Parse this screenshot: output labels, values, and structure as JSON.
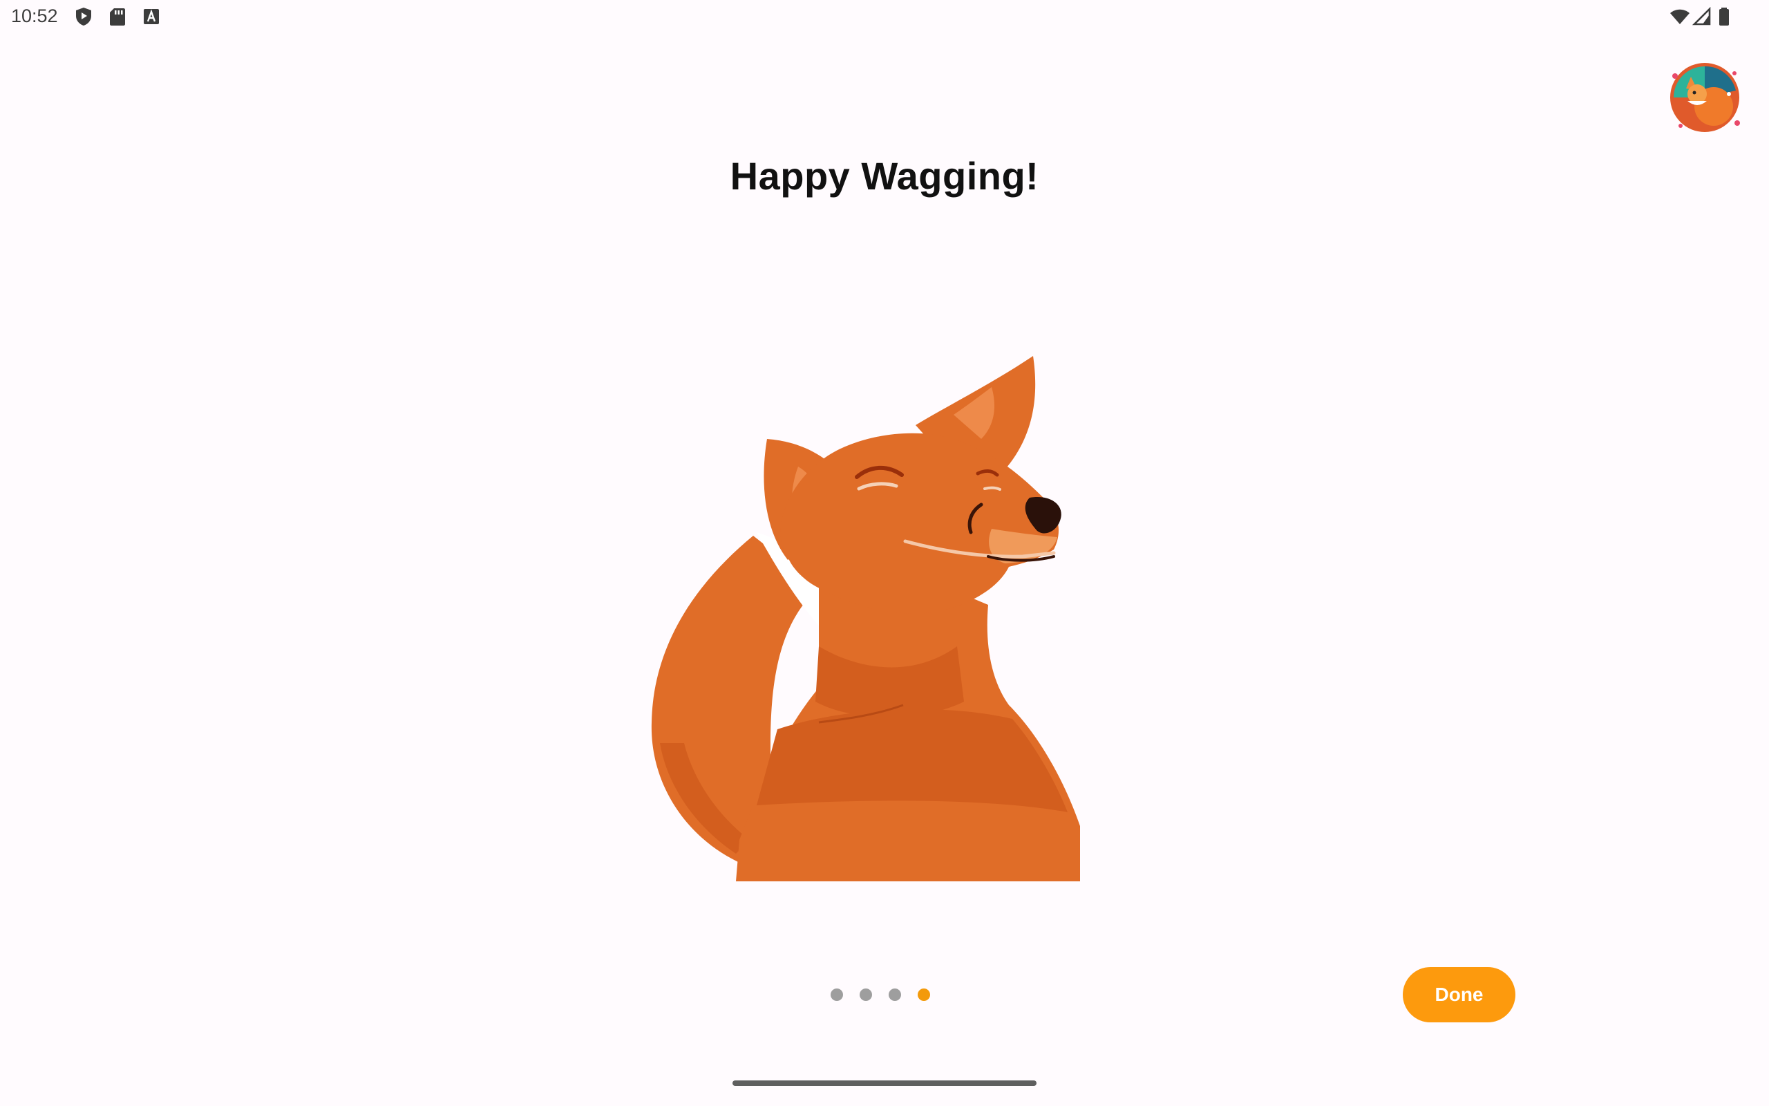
{
  "status_bar": {
    "time": "10:52",
    "left_icons": [
      "play-shield-icon",
      "sd-card-icon",
      "accessibility-a-icon"
    ],
    "right_icons": [
      "wifi-icon",
      "cell-signal-icon",
      "battery-icon"
    ]
  },
  "onboarding": {
    "title": "Happy Wagging!",
    "illustration": "smiling-fox-illustration",
    "page_indicator": {
      "total": 4,
      "current": 4
    },
    "done_label": "Done"
  },
  "colors": {
    "accent": "#fd9a0d",
    "active_dot": "#f39a0b",
    "inactive_dot": "#9e9e9e",
    "fox_orange": "#e06d28",
    "background": "#fffbfe"
  }
}
